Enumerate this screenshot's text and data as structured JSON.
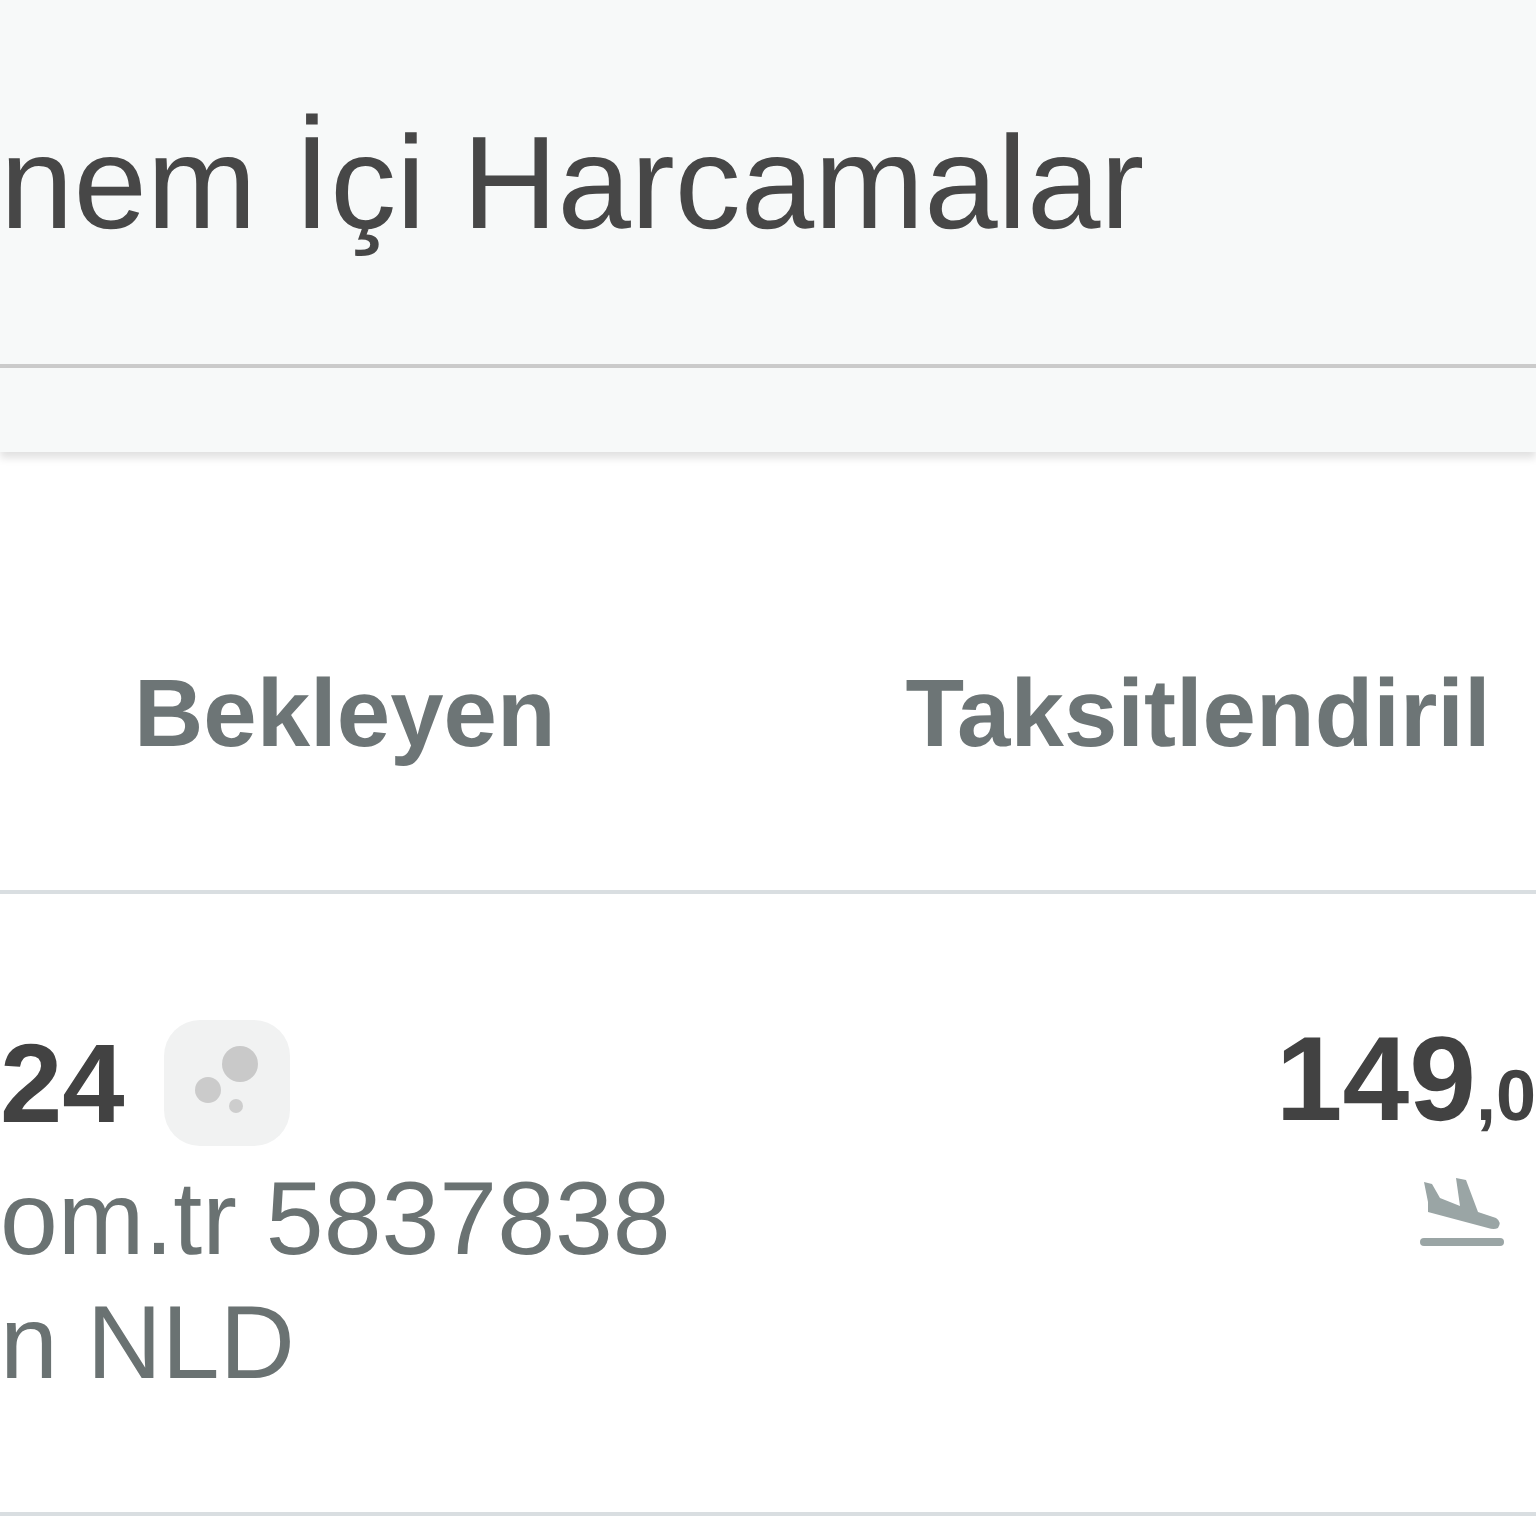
{
  "header": {
    "title": "nem İçi Harcamalar"
  },
  "tabs": [
    {
      "label": "Bekleyen",
      "selected": false
    },
    {
      "label": "Taksitlendiril",
      "selected": false
    }
  ],
  "transactions": [
    {
      "day": "24",
      "merchant": "om.tr 5837838",
      "location": "n NLD",
      "amount_whole": "149",
      "amount_fraction": ",0"
    }
  ]
}
